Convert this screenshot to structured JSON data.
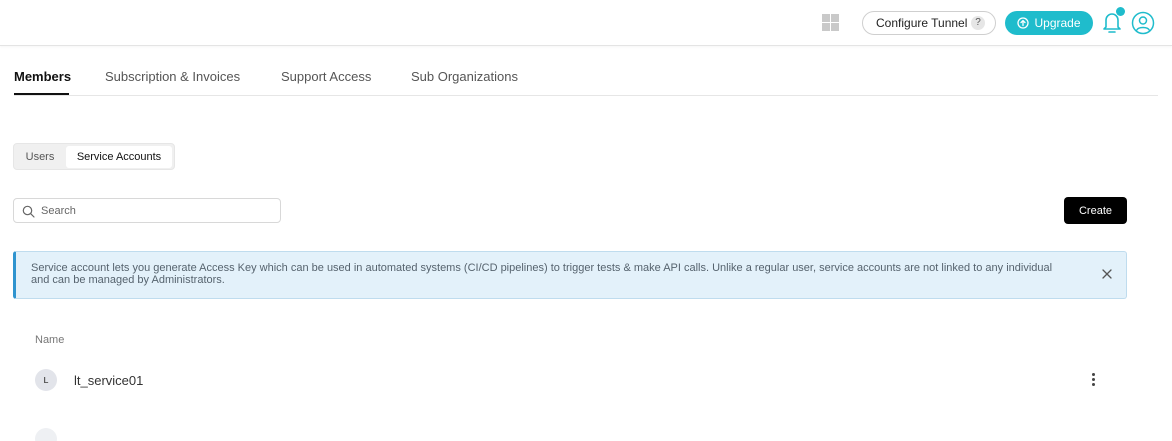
{
  "header": {
    "configure_tunnel_label": "Configure Tunnel",
    "help_badge": "?",
    "upgrade_label": "Upgrade",
    "accent_color": "#1fbccc"
  },
  "tabs": [
    {
      "label": "Members",
      "active": true
    },
    {
      "label": "Subscription & Invoices",
      "active": false
    },
    {
      "label": "Support Access",
      "active": false
    },
    {
      "label": "Sub Organizations",
      "active": false
    }
  ],
  "segmented": {
    "users_label": "Users",
    "service_accounts_label": "Service Accounts",
    "selected": "Service Accounts"
  },
  "search": {
    "placeholder": "Search",
    "value": ""
  },
  "create_label": "Create",
  "banner": {
    "text": "Service account lets you generate Access Key which can be used in automated systems (CI/CD pipelines) to trigger tests & make API calls. Unlike a regular user, service accounts are not linked to any individual and can be managed by Administrators."
  },
  "table": {
    "column_name": "Name",
    "rows": [
      {
        "avatar_initial": "L",
        "name": "lt_service01"
      }
    ]
  },
  "icons": {
    "apps": "apps-grid-icon",
    "upgrade": "arrow-up-circle-icon",
    "bell": "bell-icon",
    "user": "user-circle-icon",
    "search": "search-icon",
    "close": "close-icon",
    "menu": "more-vertical-icon"
  }
}
